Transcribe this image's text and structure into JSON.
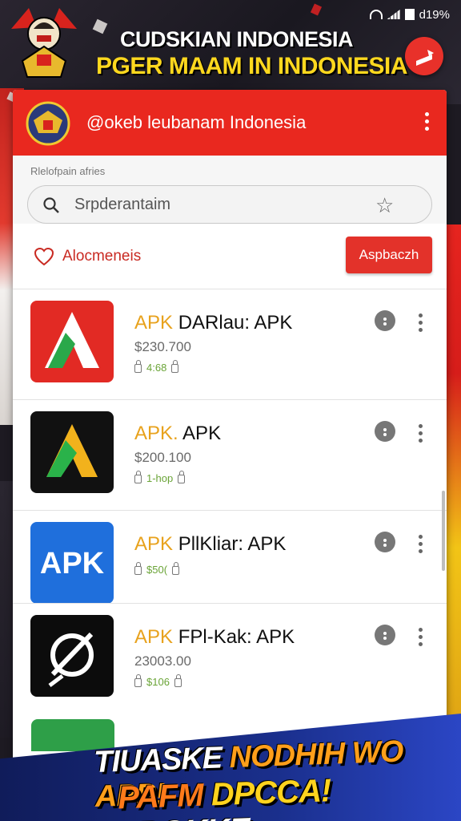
{
  "status_bar": {
    "battery_text": "d19%"
  },
  "banner": {
    "title_line1": "CUDSKIAN INDONESIA",
    "title_line2": "PGER MAAM IN INDONESIA"
  },
  "appbar": {
    "title": "@okeb leubanam Indonesia"
  },
  "search": {
    "caption": "Rlelofpain afries",
    "placeholder": "Srpderantaim"
  },
  "filter": {
    "label": "Alocmeneis",
    "apply_button": "Aspbaczh"
  },
  "apps": [
    {
      "prefix": "APK",
      "name": "DARlau: APK",
      "size": "$230.700",
      "meta": "4:68"
    },
    {
      "prefix": "APK.",
      "name": "APK",
      "size": "$200.100",
      "meta": "1-hop"
    },
    {
      "prefix": "APK",
      "name": "PllKliar: APK",
      "size": "",
      "meta": "$50("
    },
    {
      "prefix": "APK",
      "name": "FPl-Kak: APK",
      "size": "23003.00",
      "meta": "$106"
    }
  ],
  "promo": {
    "line1_a": "TIUASKE",
    "line1_b": "NODHIH WO APP!",
    "line2_a": "PAFM",
    "line2_b": "DPCCA!",
    "line2_c": "FROKKE"
  },
  "colors": {
    "brand_red": "#e9281f",
    "apk_orange": "#e8a21d",
    "promo_blue": "#1a2f8c",
    "banner_yellow": "#ffd81e"
  }
}
